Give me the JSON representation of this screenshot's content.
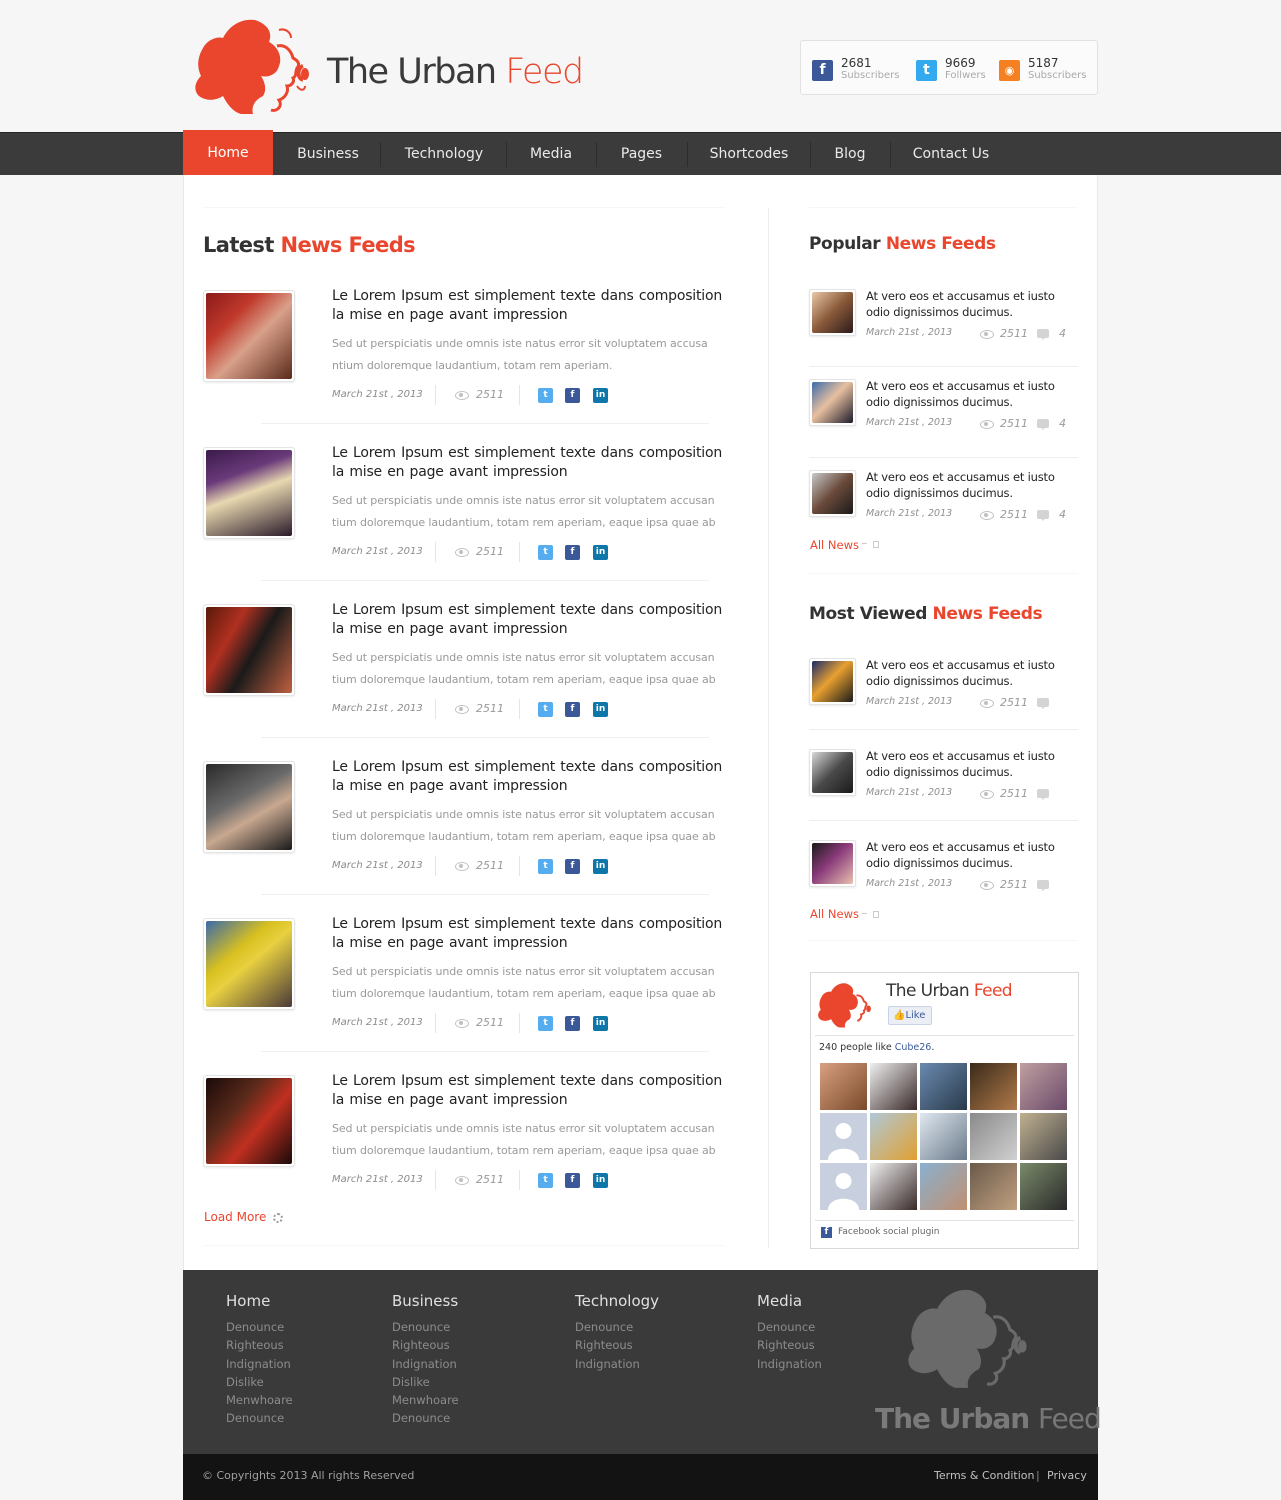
{
  "brand": {
    "name_main": "The Urban ",
    "name_accent": "Feed"
  },
  "social": [
    {
      "icon": "facebook-icon",
      "glyph": "f",
      "color": "#3b5998",
      "count": "2681",
      "label": "Subscribers"
    },
    {
      "icon": "twitter-icon",
      "glyph": "t",
      "color": "#33aaee",
      "count": "9669",
      "label": "Follwers"
    },
    {
      "icon": "rss-icon",
      "glyph": "◉",
      "color": "#f58022",
      "count": "5187",
      "label": "Subscribers"
    }
  ],
  "nav": {
    "active": "Home",
    "items": [
      "Business",
      "Technology",
      "Media",
      "Pages",
      "Shortcodes",
      "Blog",
      "Contact Us"
    ]
  },
  "latest": {
    "title_main": "Latest ",
    "title_accent": "News Feeds",
    "items": [
      {
        "title": "Le Lorem Ipsum est simplement  texte  dans  composition la mise en page avant impression",
        "excerpt": "Sed ut perspiciatis unde omnis iste natus error sit voluptatem accusa ntium doloremque laudantium, totam rem aperiam.",
        "date": "March 21st , 2013",
        "views": "2511"
      },
      {
        "title": "Le Lorem Ipsum est simplement  texte  dans  composition la mise en page avant impression",
        "excerpt": "Sed ut perspiciatis unde omnis iste natus error sit voluptatem accusan tium doloremque laudantium, totam rem aperiam, eaque ipsa quae ab",
        "date": "March 21st , 2013",
        "views": "2511"
      },
      {
        "title": "Le Lorem Ipsum est simplement  texte  dans  composition la mise en page avant impression",
        "excerpt": "Sed ut perspiciatis unde omnis iste natus error sit voluptatem accusan tium doloremque laudantium, totam rem aperiam, eaque ipsa quae ab",
        "date": "March 21st , 2013",
        "views": "2511"
      },
      {
        "title": "Le Lorem Ipsum est simplement  texte  dans  composition la mise en page avant impression",
        "excerpt": "Sed ut perspiciatis unde omnis iste natus error sit voluptatem accusan tium doloremque laudantium, totam rem aperiam, eaque ipsa quae ab",
        "date": "March 21st , 2013",
        "views": "2511"
      },
      {
        "title": "Le Lorem Ipsum est simplement  texte  dans  composition la mise en page avant impression",
        "excerpt": "Sed ut perspiciatis unde omnis iste natus error sit voluptatem accusan tium doloremque laudantium, totam rem aperiam, eaque ipsa quae ab",
        "date": "March 21st , 2013",
        "views": "2511"
      },
      {
        "title": "Le Lorem Ipsum est simplement  texte  dans  composition la mise en page avant impression",
        "excerpt": "Sed ut perspiciatis unde omnis iste natus error sit voluptatem accusan tium doloremque laudantium, totam rem aperiam, eaque ipsa quae ab",
        "date": "March 21st , 2013",
        "views": "2511"
      }
    ],
    "load_more": "Load More"
  },
  "popular": {
    "title_main": "Popular ",
    "title_accent": "News Feeds",
    "items": [
      {
        "title": "At vero eos et accusamus et iusto odio dignissimos ducimus.",
        "date": "March 21st , 2013",
        "views": "2511",
        "comments": "4"
      },
      {
        "title": "At vero eos et accusamus et iusto odio dignissimos ducimus.",
        "date": "March 21st , 2013",
        "views": "2511",
        "comments": "4"
      },
      {
        "title": "At vero eos et accusamus et iusto odio dignissimos ducimus.",
        "date": "March 21st , 2013",
        "views": "2511",
        "comments": "4"
      }
    ],
    "all_news": "All News"
  },
  "most_viewed": {
    "title_main": "Most Viewed ",
    "title_accent": "News Feeds",
    "items": [
      {
        "title": "At vero eos et accusamus et iusto odio dignissimos ducimus.",
        "date": "March 21st , 2013",
        "views": "2511"
      },
      {
        "title": "At vero eos et accusamus et iusto odio dignissimos ducimus.",
        "date": "March 21st , 2013",
        "views": "2511"
      },
      {
        "title": "At vero eos et accusamus et iusto odio dignissimos ducimus.",
        "date": "March 21st , 2013",
        "views": "2511"
      }
    ],
    "all_news": "All News"
  },
  "facebook": {
    "name_main": "The Urban ",
    "name_accent": "Feed",
    "like": "Like",
    "count_text": "240 people like ",
    "count_link": "Cube26",
    "count_dot": ".",
    "plugin": "Facebook social plugin"
  },
  "footer": {
    "columns": [
      {
        "heading": "Home",
        "links": [
          "Denounce",
          "Righteous",
          "Indignation",
          "Dislike",
          "Menwhoare",
          "Denounce"
        ]
      },
      {
        "heading": "Business",
        "links": [
          "Denounce",
          "Righteous",
          "Indignation",
          "Dislike",
          "Menwhoare",
          "Denounce"
        ]
      },
      {
        "heading": "Technology",
        "links": [
          "Denounce",
          "Righteous",
          "Indignation"
        ]
      },
      {
        "heading": "Media",
        "links": [
          "Denounce",
          "Righteous",
          "Indignation"
        ]
      }
    ],
    "brand_main": "The Urban ",
    "brand_accent": "Feed",
    "copyright": "© Copyrights 2013 All rights Reserved",
    "terms": "Terms & Condition",
    "divider": "|",
    "privacy": "Privacy"
  },
  "colors": {
    "accent": "#e9462d",
    "nav": "#3b3b3b",
    "footer": "#3a3a3a",
    "bottom_bar": "#131313"
  }
}
